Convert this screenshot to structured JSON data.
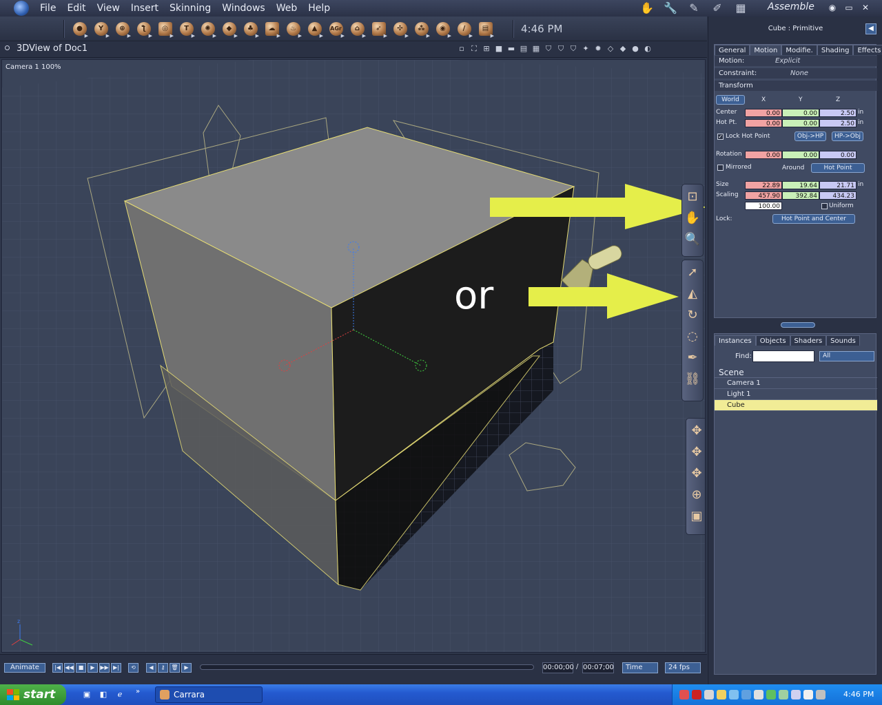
{
  "menubar": {
    "items": [
      "File",
      "Edit",
      "View",
      "Insert",
      "Skinning",
      "Windows",
      "Web",
      "Help"
    ],
    "room": "Assemble"
  },
  "toolbar": {
    "time": "4:46 PM",
    "tools": [
      {
        "name": "sphere-tool",
        "glyph": "●"
      },
      {
        "name": "cup-tool",
        "glyph": "Y"
      },
      {
        "name": "globe-tool",
        "glyph": "⊕"
      },
      {
        "name": "bone-tool",
        "glyph": "ƪ"
      },
      {
        "name": "ring-tool",
        "glyph": "◎"
      },
      {
        "name": "text-tool",
        "glyph": "T"
      },
      {
        "name": "particle-tool",
        "glyph": "✺"
      },
      {
        "name": "terrain-tool",
        "glyph": "◆"
      },
      {
        "name": "tree-tool",
        "glyph": "♣"
      },
      {
        "name": "cloud-tool",
        "glyph": "☁"
      },
      {
        "name": "fire-tool",
        "glyph": "♨"
      },
      {
        "name": "landscape-tool",
        "glyph": "▲"
      },
      {
        "name": "text3d-tool",
        "glyph": "AGr"
      },
      {
        "name": "house-tool",
        "glyph": "⌂"
      },
      {
        "name": "spotlight-tool",
        "glyph": "➶"
      },
      {
        "name": "camera-tool",
        "glyph": "✣"
      },
      {
        "name": "group-tool",
        "glyph": "⁂"
      },
      {
        "name": "target-tool",
        "glyph": "◉"
      },
      {
        "name": "wand-tool",
        "glyph": "/"
      },
      {
        "name": "book-tool",
        "glyph": "▤"
      }
    ]
  },
  "view": {
    "title": "3DView of Doc1",
    "camera": "Camera 1 100%",
    "annotation": "or"
  },
  "panel": {
    "title": "Cube : Primitive",
    "tabs": [
      "General",
      "Motion",
      "Modifie.",
      "Shading",
      "Effects"
    ],
    "motion_label": "Motion:",
    "motion_value": "Explicit",
    "constraint_label": "Constraint:",
    "constraint_value": "None",
    "transform_label": "Transform",
    "space": "World",
    "axis_x": "X",
    "axis_y": "Y",
    "axis_z": "Z",
    "center_label": "Center",
    "center": [
      "0.00",
      "0.00",
      "2.50"
    ],
    "hotpt_label": "Hot Pt.",
    "hotpt": [
      "0.00",
      "0.00",
      "2.50"
    ],
    "unit": "in",
    "lock_hot_point": "Lock Hot Point",
    "obj_hp": "Obj->HP",
    "hp_obj": "HP->Obj",
    "rotation_label": "Rotation",
    "rotation": [
      "0.00",
      "0.00",
      "0.00"
    ],
    "mirrored": "Mirrored",
    "around_label": "Around",
    "around_value": "Hot Point",
    "size_label": "Size",
    "size": [
      "22.89",
      "19.64",
      "21.71"
    ],
    "scaling_label": "Scaling",
    "scaling": [
      "457.90",
      "392.84",
      "434.23"
    ],
    "uniform_value": "100.00",
    "uniform": "Uniform",
    "lock_label": "Lock:",
    "lock_value": "Hot Point and Center"
  },
  "instances": {
    "tabs": [
      "Instances",
      "Objects",
      "Shaders",
      "Sounds"
    ],
    "find_label": "Find:",
    "find_value": "",
    "filter": "All",
    "scene": "Scene",
    "items": [
      "Camera 1",
      "Light 1",
      "Cube"
    ]
  },
  "timeline": {
    "animate": "Animate",
    "time_current": "00:00;00",
    "time_slash": "/",
    "time_end": "00:07;00",
    "display": "Time",
    "fps": "24 fps"
  },
  "taskbar": {
    "start": "start",
    "task": "Carrara",
    "clock": "4:46 PM"
  },
  "colors": {
    "arrow": "#e5ee4a",
    "selection": "#f1ec96",
    "accent": "#3c5f93"
  }
}
